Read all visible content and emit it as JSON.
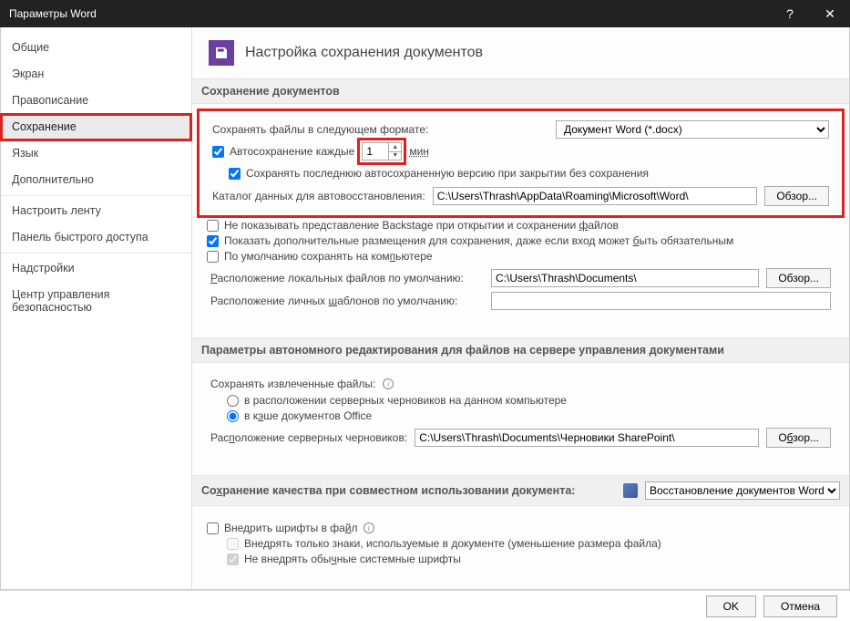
{
  "window": {
    "title": "Параметры Word"
  },
  "sidebar": {
    "items": [
      {
        "label": "Общие"
      },
      {
        "label": "Экран"
      },
      {
        "label": "Правописание"
      },
      {
        "label": "Сохранение",
        "selected": true
      },
      {
        "label": "Язык"
      },
      {
        "label": "Дополнительно"
      }
    ],
    "items2": [
      {
        "label": "Настроить ленту"
      },
      {
        "label": "Панель быстрого доступа"
      }
    ],
    "items3": [
      {
        "label": "Надстройки"
      },
      {
        "label": "Центр управления безопасностью"
      }
    ]
  },
  "header": {
    "title": "Настройка сохранения документов"
  },
  "save": {
    "section": "Сохранение документов",
    "format_label": "Сохранять файлы в следующем формате:",
    "format_value": "Документ Word (*.docx)",
    "auto_label": "Автосохранение каждые",
    "auto_value": "1",
    "auto_unit": "мин",
    "keep_last": "Сохранять последнюю автосохраненную версию при закрытии без сохранения",
    "catalog_label": "Каталог данных для автовосстановления:",
    "catalog_value": "C:\\Users\\Thrash\\AppData\\Roaming\\Microsoft\\Word\\",
    "browse": "Обзор...",
    "no_backstage": "Не показывать представление Backstage при открытии и сохранении файлов",
    "show_addl": "Показать дополнительные размещения для сохранения, даже если вход может быть обязательным",
    "default_pc": "По умолчанию сохранять на компьютере",
    "local_label": "Расположение локальных файлов по умолчанию:",
    "local_value": "C:\\Users\\Thrash\\Documents\\",
    "tmpl_label": "Расположение личных шаблонов по умолчанию:",
    "tmpl_value": ""
  },
  "offline": {
    "section": "Параметры автономного редактирования для файлов на сервере управления документами",
    "keep_label": "Сохранять извлеченные файлы:",
    "opt1": "в расположении серверных черновиков на данном компьютере",
    "opt2": "в кэше документов Office",
    "drafts_label": "Расположение серверных черновиков:",
    "drafts_value": "C:\\Users\\Thrash\\Documents\\Черновики SharePoint\\",
    "browse": "Обзор..."
  },
  "quality": {
    "section": "Сохранение качества при совместном использовании документа:",
    "doc": "Восстановление документов Word",
    "embed": "Внедрить шрифты в файл",
    "only_used": "Внедрять только знаки, используемые в документе (уменьшение размера файла)",
    "no_system": "Не внедрять обычные системные шрифты"
  },
  "footer": {
    "ok": "OK",
    "cancel": "Отмена"
  }
}
